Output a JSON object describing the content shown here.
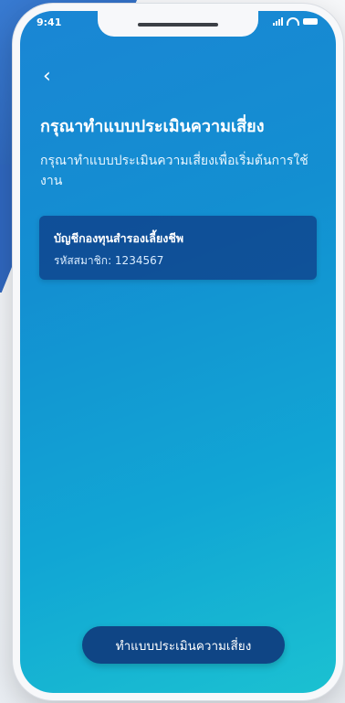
{
  "status_bar": {
    "time": "9:41"
  },
  "nav": {
    "back_icon": "chevron-left-icon",
    "back_glyph": "‹"
  },
  "header": {
    "title": "กรุณาทำแบบประเมินความเสี่ยง",
    "subtitle": "กรุณาทำแบบประเมินความเสี่ยงเพื่อเริ่มต้นการใช้งาน"
  },
  "account_card": {
    "title": "บัญชีกองทุนสำรองเลี้ยงชีพ",
    "member_id": "รหัสสมาชิก: 1234567"
  },
  "cta": {
    "label": "ทำแบบประเมินความเสี่ยง"
  },
  "colors": {
    "screen_gradient_start": "#1a86d4",
    "screen_gradient_end": "#1bc1d1",
    "card_bg": "#0e3882",
    "button_bg": "#0f4585",
    "text": "#ffffff"
  }
}
